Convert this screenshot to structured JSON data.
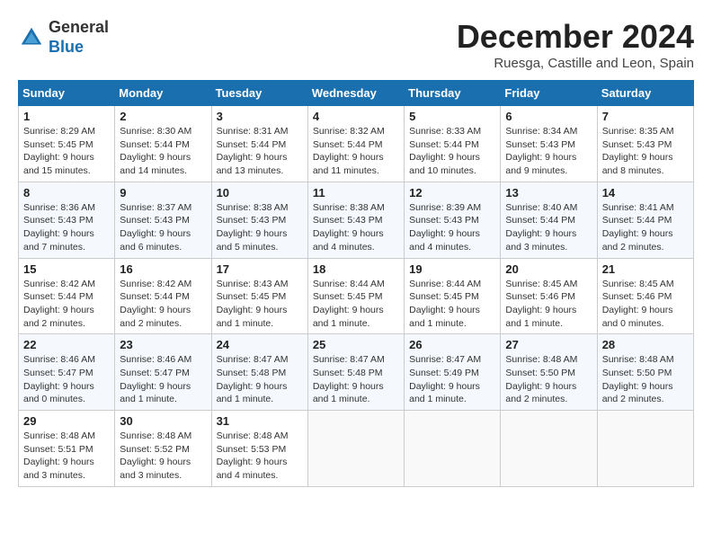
{
  "header": {
    "logo_line1": "General",
    "logo_line2": "Blue",
    "month": "December 2024",
    "location": "Ruesga, Castille and Leon, Spain"
  },
  "weekdays": [
    "Sunday",
    "Monday",
    "Tuesday",
    "Wednesday",
    "Thursday",
    "Friday",
    "Saturday"
  ],
  "weeks": [
    [
      {
        "day": "1",
        "info": "Sunrise: 8:29 AM\nSunset: 5:45 PM\nDaylight: 9 hours\nand 15 minutes."
      },
      {
        "day": "2",
        "info": "Sunrise: 8:30 AM\nSunset: 5:44 PM\nDaylight: 9 hours\nand 14 minutes."
      },
      {
        "day": "3",
        "info": "Sunrise: 8:31 AM\nSunset: 5:44 PM\nDaylight: 9 hours\nand 13 minutes."
      },
      {
        "day": "4",
        "info": "Sunrise: 8:32 AM\nSunset: 5:44 PM\nDaylight: 9 hours\nand 11 minutes."
      },
      {
        "day": "5",
        "info": "Sunrise: 8:33 AM\nSunset: 5:44 PM\nDaylight: 9 hours\nand 10 minutes."
      },
      {
        "day": "6",
        "info": "Sunrise: 8:34 AM\nSunset: 5:43 PM\nDaylight: 9 hours\nand 9 minutes."
      },
      {
        "day": "7",
        "info": "Sunrise: 8:35 AM\nSunset: 5:43 PM\nDaylight: 9 hours\nand 8 minutes."
      }
    ],
    [
      {
        "day": "8",
        "info": "Sunrise: 8:36 AM\nSunset: 5:43 PM\nDaylight: 9 hours\nand 7 minutes."
      },
      {
        "day": "9",
        "info": "Sunrise: 8:37 AM\nSunset: 5:43 PM\nDaylight: 9 hours\nand 6 minutes."
      },
      {
        "day": "10",
        "info": "Sunrise: 8:38 AM\nSunset: 5:43 PM\nDaylight: 9 hours\nand 5 minutes."
      },
      {
        "day": "11",
        "info": "Sunrise: 8:38 AM\nSunset: 5:43 PM\nDaylight: 9 hours\nand 4 minutes."
      },
      {
        "day": "12",
        "info": "Sunrise: 8:39 AM\nSunset: 5:43 PM\nDaylight: 9 hours\nand 4 minutes."
      },
      {
        "day": "13",
        "info": "Sunrise: 8:40 AM\nSunset: 5:44 PM\nDaylight: 9 hours\nand 3 minutes."
      },
      {
        "day": "14",
        "info": "Sunrise: 8:41 AM\nSunset: 5:44 PM\nDaylight: 9 hours\nand 2 minutes."
      }
    ],
    [
      {
        "day": "15",
        "info": "Sunrise: 8:42 AM\nSunset: 5:44 PM\nDaylight: 9 hours\nand 2 minutes."
      },
      {
        "day": "16",
        "info": "Sunrise: 8:42 AM\nSunset: 5:44 PM\nDaylight: 9 hours\nand 2 minutes."
      },
      {
        "day": "17",
        "info": "Sunrise: 8:43 AM\nSunset: 5:45 PM\nDaylight: 9 hours\nand 1 minute."
      },
      {
        "day": "18",
        "info": "Sunrise: 8:44 AM\nSunset: 5:45 PM\nDaylight: 9 hours\nand 1 minute."
      },
      {
        "day": "19",
        "info": "Sunrise: 8:44 AM\nSunset: 5:45 PM\nDaylight: 9 hours\nand 1 minute."
      },
      {
        "day": "20",
        "info": "Sunrise: 8:45 AM\nSunset: 5:46 PM\nDaylight: 9 hours\nand 1 minute."
      },
      {
        "day": "21",
        "info": "Sunrise: 8:45 AM\nSunset: 5:46 PM\nDaylight: 9 hours\nand 0 minutes."
      }
    ],
    [
      {
        "day": "22",
        "info": "Sunrise: 8:46 AM\nSunset: 5:47 PM\nDaylight: 9 hours\nand 0 minutes."
      },
      {
        "day": "23",
        "info": "Sunrise: 8:46 AM\nSunset: 5:47 PM\nDaylight: 9 hours\nand 1 minute."
      },
      {
        "day": "24",
        "info": "Sunrise: 8:47 AM\nSunset: 5:48 PM\nDaylight: 9 hours\nand 1 minute."
      },
      {
        "day": "25",
        "info": "Sunrise: 8:47 AM\nSunset: 5:48 PM\nDaylight: 9 hours\nand 1 minute."
      },
      {
        "day": "26",
        "info": "Sunrise: 8:47 AM\nSunset: 5:49 PM\nDaylight: 9 hours\nand 1 minute."
      },
      {
        "day": "27",
        "info": "Sunrise: 8:48 AM\nSunset: 5:50 PM\nDaylight: 9 hours\nand 2 minutes."
      },
      {
        "day": "28",
        "info": "Sunrise: 8:48 AM\nSunset: 5:50 PM\nDaylight: 9 hours\nand 2 minutes."
      }
    ],
    [
      {
        "day": "29",
        "info": "Sunrise: 8:48 AM\nSunset: 5:51 PM\nDaylight: 9 hours\nand 3 minutes."
      },
      {
        "day": "30",
        "info": "Sunrise: 8:48 AM\nSunset: 5:52 PM\nDaylight: 9 hours\nand 3 minutes."
      },
      {
        "day": "31",
        "info": "Sunrise: 8:48 AM\nSunset: 5:53 PM\nDaylight: 9 hours\nand 4 minutes."
      },
      {
        "day": "",
        "info": ""
      },
      {
        "day": "",
        "info": ""
      },
      {
        "day": "",
        "info": ""
      },
      {
        "day": "",
        "info": ""
      }
    ]
  ]
}
